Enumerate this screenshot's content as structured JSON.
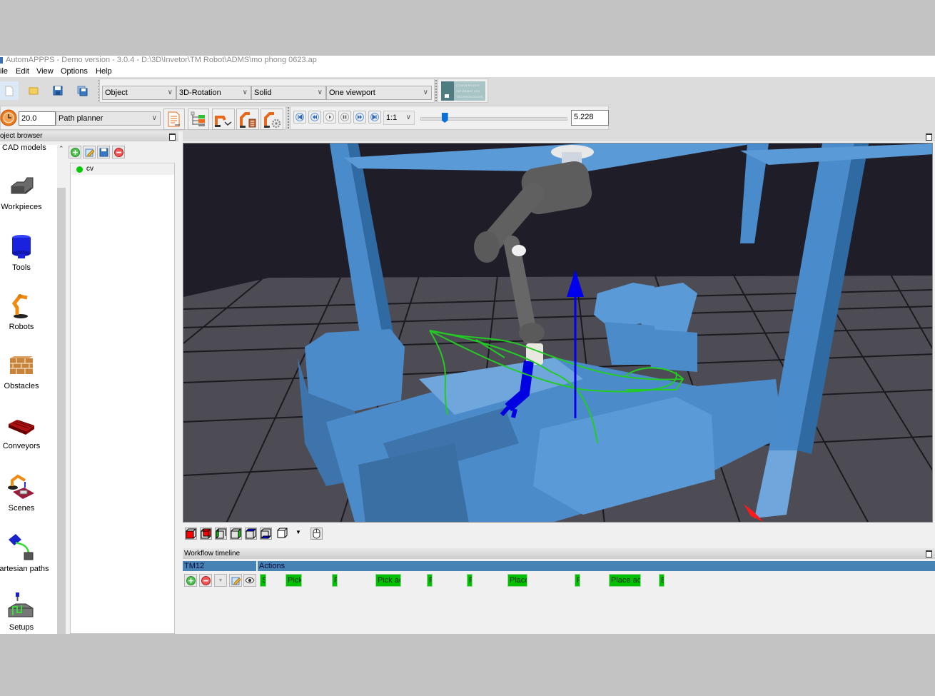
{
  "window": {
    "title": "AutomAPPPS - Demo version - 3.0.4 - D:\\3D\\Invetor\\TM Robot\\ADMS\\mo phong 0623.ap"
  },
  "menu": [
    "ile",
    "Edit",
    "View",
    "Options",
    "Help"
  ],
  "toolbar1": {
    "file_buttons": [
      "new-file",
      "open-folder",
      "save",
      "save-all"
    ],
    "selects": [
      {
        "name": "selection-mode",
        "value": "Object"
      },
      {
        "name": "navigation-mode",
        "value": "3D-Rotation"
      },
      {
        "name": "render-mode",
        "value": "Solid"
      },
      {
        "name": "viewport-layout",
        "value": "One viewport"
      }
    ],
    "logo_lines": [
      "CONVERGENT",
      "INFORMATION",
      "TECHNOLOGIES"
    ]
  },
  "toolbar2": {
    "time_value": "20.0",
    "planner": "Path planner",
    "playback_speed": "1:1",
    "timeline_position": 0.16,
    "time_readout": "5.228"
  },
  "object_browser": {
    "title": "oject browser",
    "category_header": "CAD models",
    "categories": [
      {
        "label": "Workpieces",
        "icon": "workpiece-icon"
      },
      {
        "label": "Tools",
        "icon": "tool-icon"
      },
      {
        "label": "Robots",
        "icon": "robot-icon"
      },
      {
        "label": "Obstacles",
        "icon": "obstacle-icon"
      },
      {
        "label": "Conveyors",
        "icon": "conveyor-icon"
      },
      {
        "label": "Scenes",
        "icon": "scene-icon"
      },
      {
        "label": "Cartesian paths",
        "icon": "cartesian-path-icon"
      },
      {
        "label": "Setups",
        "icon": "setup-icon"
      }
    ],
    "items": [
      {
        "label": "cv",
        "status_color": "#00cc00"
      }
    ]
  },
  "viewport": {
    "view_buttons": [
      "front",
      "back",
      "left",
      "right",
      "top",
      "bottom",
      "iso"
    ],
    "colors": {
      "background": "#1e1d28",
      "floor": "#4d4c55",
      "model": "#4c8bc9",
      "path": "#22cc22",
      "axis_z": "#0000ee",
      "axis_x": "#ff1a1a"
    }
  },
  "workflow": {
    "title": "Workflow timeline",
    "robot_column": "TM12",
    "actions_column": "Actions",
    "actions": [
      "S",
      "Pick",
      "P",
      "Pick act",
      "P",
      "P",
      "Place",
      "P",
      "Place act",
      "E"
    ]
  }
}
